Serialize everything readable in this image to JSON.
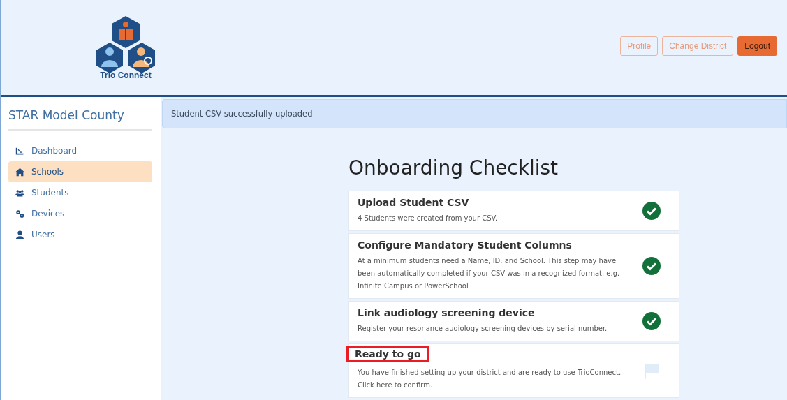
{
  "header": {
    "logo_text": "Trio Connect",
    "buttons": [
      {
        "label": "Profile",
        "kind": "outline"
      },
      {
        "label": "Change District",
        "kind": "outline"
      },
      {
        "label": "Logout",
        "kind": "solid"
      }
    ]
  },
  "sidebar": {
    "title": "STAR Model County",
    "items": [
      {
        "label": "Dashboard",
        "selected": false
      },
      {
        "label": "Schools",
        "selected": true
      },
      {
        "label": "Students",
        "selected": false
      },
      {
        "label": "Devices",
        "selected": false
      },
      {
        "label": "Users",
        "selected": false
      }
    ]
  },
  "alert": "Student CSV successfully uploaded",
  "checklist": {
    "title": "Onboarding Checklist",
    "steps": [
      {
        "title": "Upload Student CSV",
        "description": "4 Students were created from your CSV.",
        "done": true,
        "highlighted": false
      },
      {
        "title": "Configure Mandatory Student Columns",
        "description": "At a minimum students need a Name, ID, and School. This step may have been automatically completed if your CSV was in a recognized format. e.g. Infinite Campus or PowerSchool",
        "done": true,
        "highlighted": false
      },
      {
        "title": "Link audiology screening device",
        "description": "Register your resonance audiology screening devices by serial number.",
        "done": true,
        "highlighted": false
      },
      {
        "title": "Ready to go",
        "description": "You have finished setting up your district and are ready to use TrioConnect. Click here to confirm.",
        "done": false,
        "highlighted": true
      }
    ]
  }
}
